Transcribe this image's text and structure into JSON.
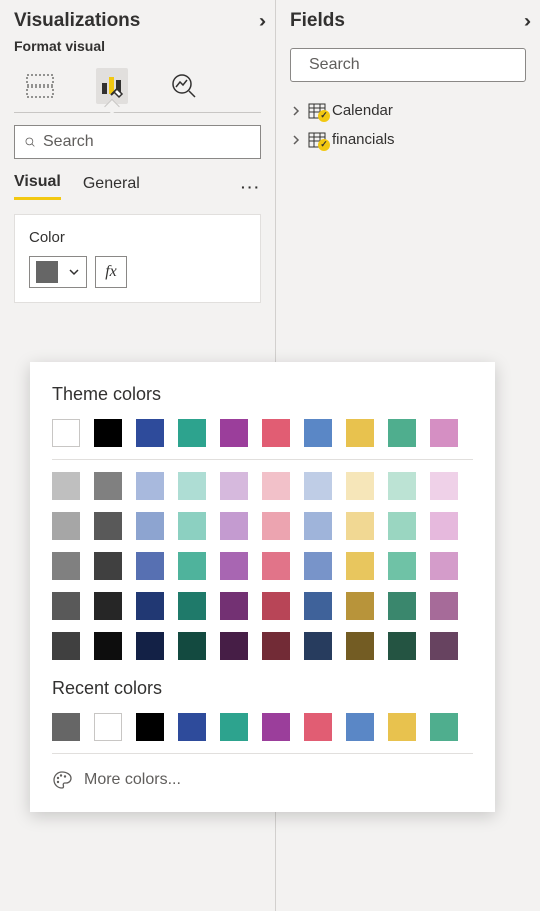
{
  "visualizations": {
    "title": "Visualizations",
    "subtitle": "Format visual",
    "search_placeholder": "Search",
    "tabs": {
      "visual": "Visual",
      "general": "General"
    },
    "color_card": {
      "label": "Color",
      "fx": "fx",
      "current": "#666666"
    }
  },
  "fields": {
    "title": "Fields",
    "search_placeholder": "Search",
    "tables": [
      {
        "name": "Calendar"
      },
      {
        "name": "financials"
      }
    ]
  },
  "color_picker": {
    "theme_label": "Theme colors",
    "recent_label": "Recent colors",
    "more_label": "More colors...",
    "theme_primary": [
      "#FFFFFF",
      "#000000",
      "#2E4B9B",
      "#2DA38E",
      "#9B3E9B",
      "#E15D73",
      "#5A87C6",
      "#E8C24E",
      "#4FAE8E",
      "#D58FC3"
    ],
    "theme_variants": [
      [
        "#BFBFBF",
        "#808080",
        "#A8B9DD",
        "#AEDDD4",
        "#D6B9DD",
        "#F2C1C9",
        "#BFCDE6",
        "#F6E6B9",
        "#BCE3D4",
        "#EFD1E8"
      ],
      [
        "#A6A6A6",
        "#595959",
        "#8DA4D0",
        "#8CD0C1",
        "#C49BD0",
        "#ECA4B0",
        "#9FB4DA",
        "#F1D893",
        "#9AD6C1",
        "#E6B9DD"
      ],
      [
        "#808080",
        "#404040",
        "#5770B2",
        "#4FB39C",
        "#A866B2",
        "#E17489",
        "#7894C9",
        "#E8C65E",
        "#6FC2A6",
        "#D49CCA"
      ],
      [
        "#595959",
        "#262626",
        "#213873",
        "#1F7A6A",
        "#733173",
        "#B84557",
        "#3F629A",
        "#B8943A",
        "#3A876D",
        "#A66B99"
      ],
      [
        "#404040",
        "#0D0D0D",
        "#132146",
        "#134A40",
        "#461E46",
        "#722B36",
        "#273C5E",
        "#735C23",
        "#245442",
        "#674360"
      ]
    ],
    "recent": [
      "#666666",
      "#FFFFFF",
      "#000000",
      "#2E4B9B",
      "#2DA38E",
      "#9B3E9B",
      "#E15D73",
      "#5A87C6",
      "#E8C24E",
      "#4FAE8E"
    ]
  }
}
